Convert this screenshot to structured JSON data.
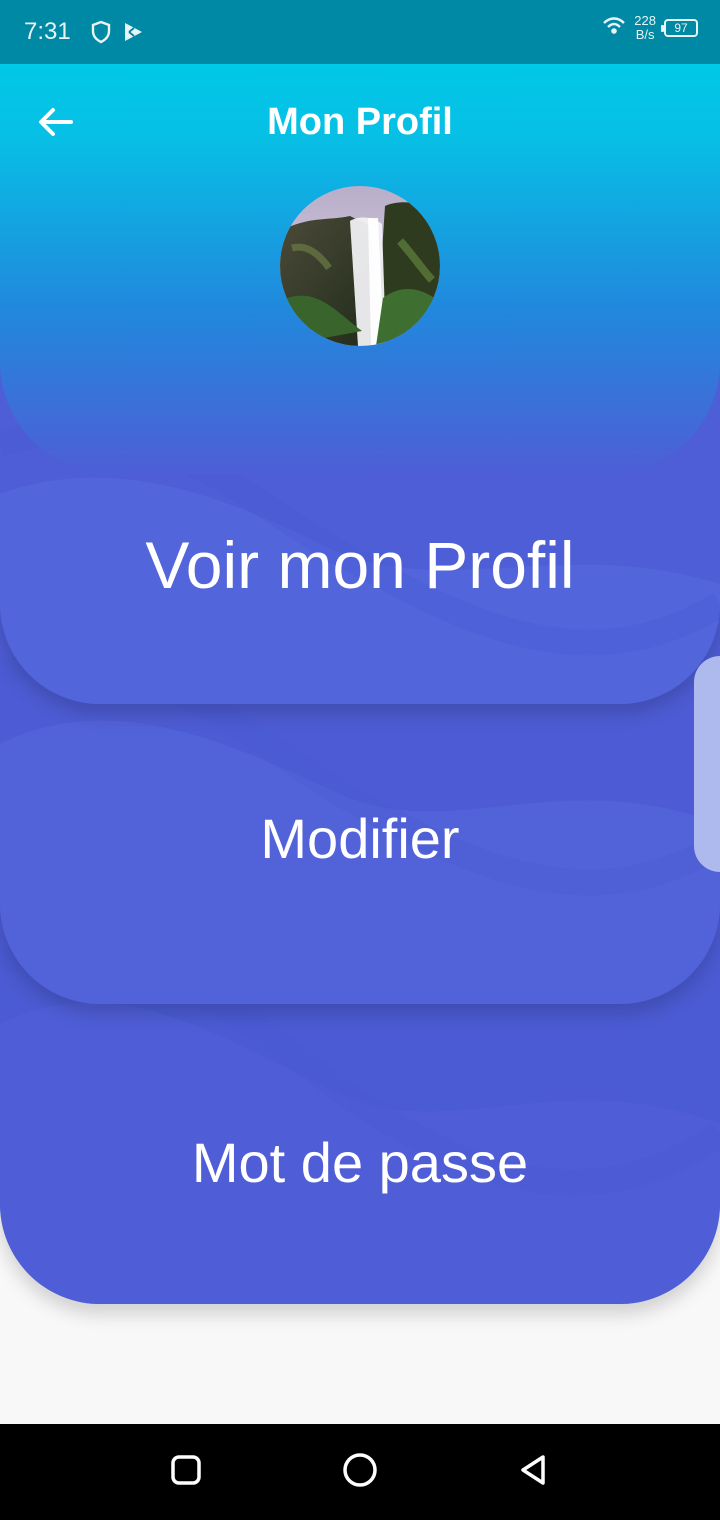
{
  "status_bar": {
    "time": "7:31",
    "net_speed_value": "228",
    "net_speed_unit": "B/s",
    "battery_level": "97",
    "left_icons": [
      "shield-icon",
      "play-store-icon"
    ],
    "right_icons": [
      "wifi-icon",
      "battery-icon"
    ]
  },
  "header": {
    "title": "Mon Profil",
    "back_icon": "arrow-back-icon",
    "avatar_icon": "waterfall-profile-photo"
  },
  "menu": {
    "view_profile_label": "Voir mon Profil",
    "edit_label": "Modifier",
    "password_label": "Mot de passe"
  },
  "navigation_bar": {
    "buttons": [
      "recent-apps-icon",
      "home-icon",
      "back-triangle-icon"
    ]
  },
  "colors": {
    "status_bar": "#0089a4",
    "header_top": "#00c8e7",
    "card_blue": "#4e5ed6",
    "background": "#f8f8f8",
    "handle": "#aeb9ed"
  }
}
